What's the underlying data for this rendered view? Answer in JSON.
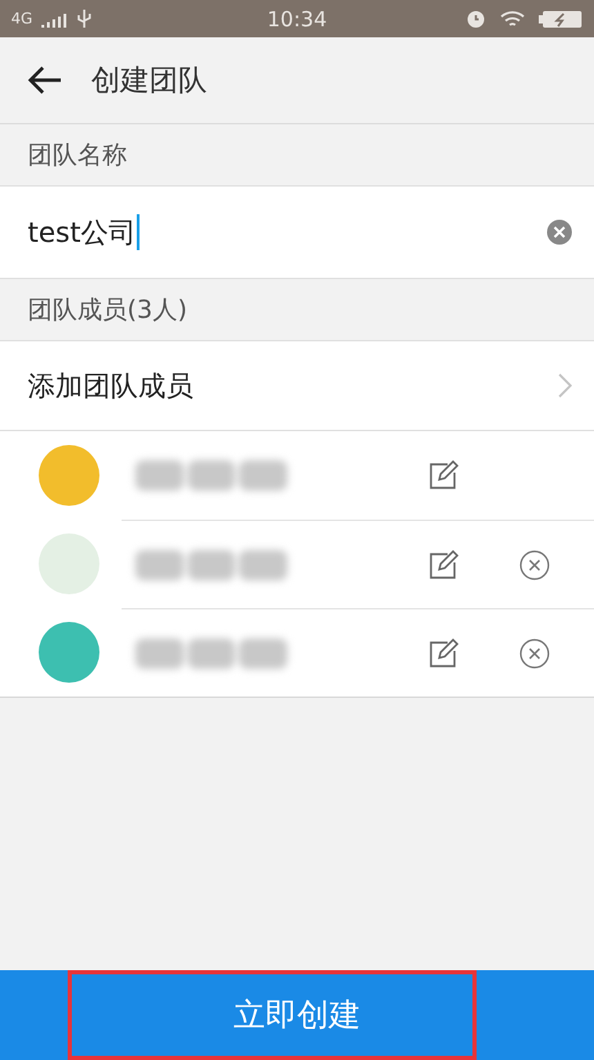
{
  "status_bar": {
    "network": "4G",
    "time": "10:34"
  },
  "header": {
    "title": "创建团队"
  },
  "team_name": {
    "label": "团队名称",
    "value": "test公司"
  },
  "members_section": {
    "label": "团队成员(3人)",
    "add_label": "添加团队成员"
  },
  "members": [
    {
      "color": "#f2bd2c",
      "removable": false
    },
    {
      "color": "#e4f0e4",
      "removable": true
    },
    {
      "color": "#3dbfb0",
      "removable": true
    }
  ],
  "submit": {
    "label": "立即创建"
  }
}
